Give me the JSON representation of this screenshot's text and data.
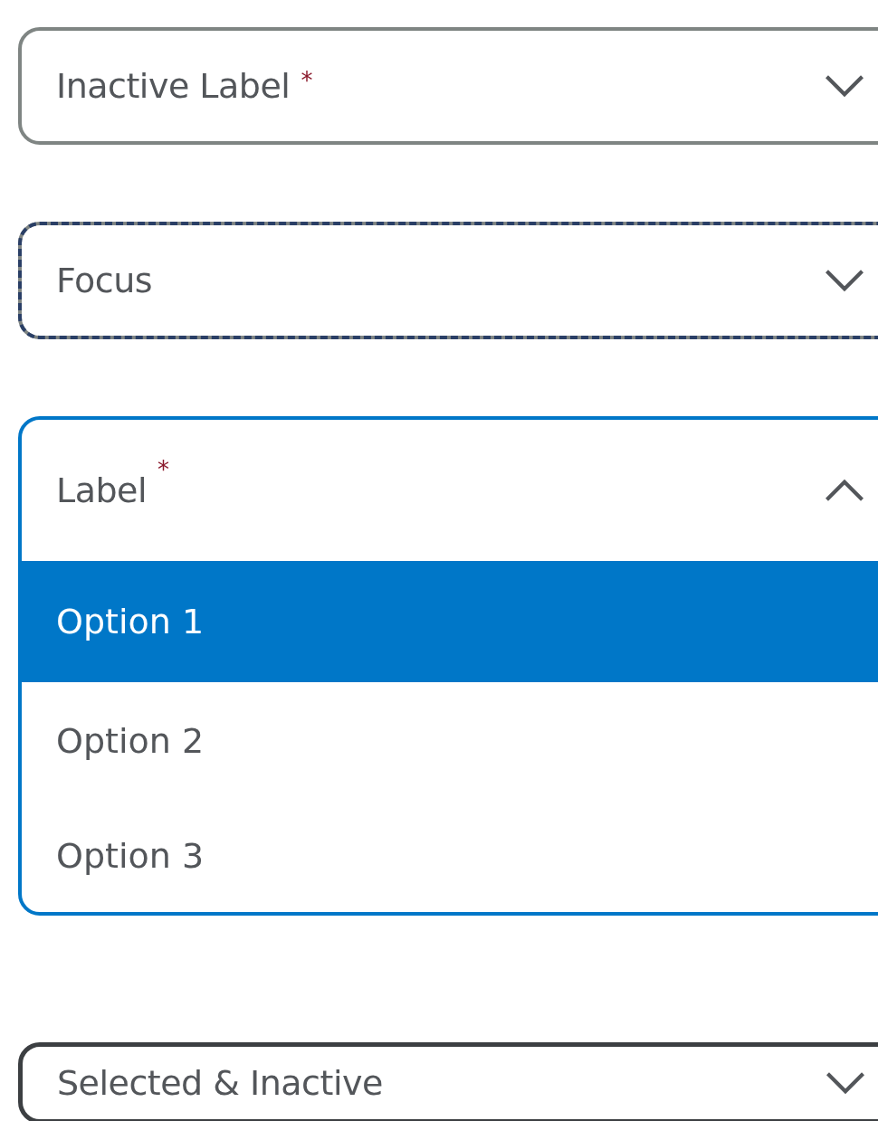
{
  "selects": [
    {
      "label": "Inactive Label",
      "required_mark": "*",
      "kind": "inactive",
      "expanded": false
    },
    {
      "label": "Focus",
      "kind": "focus",
      "expanded": false
    },
    {
      "label": "Label",
      "required_mark": "*",
      "kind": "active",
      "expanded": true,
      "options": [
        {
          "label": "Option 1",
          "selected": true
        },
        {
          "label": "Option 2",
          "selected": false
        },
        {
          "label": "Option 3",
          "selected": false
        }
      ]
    },
    {
      "label": "Selected & Inactive",
      "kind": "selected",
      "expanded": false
    }
  ]
}
